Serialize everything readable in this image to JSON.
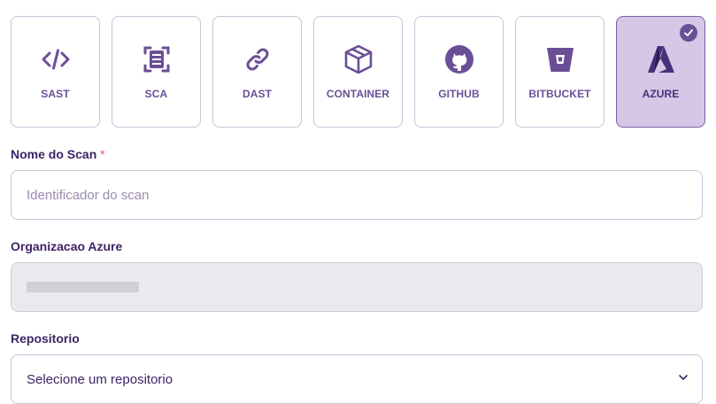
{
  "scan_types": [
    {
      "label": "SAST",
      "icon": "code-icon",
      "selected": false
    },
    {
      "label": "SCA",
      "icon": "document-scan-icon",
      "selected": false
    },
    {
      "label": "DAST",
      "icon": "link-icon",
      "selected": false
    },
    {
      "label": "CONTAINER",
      "icon": "box-icon",
      "selected": false
    },
    {
      "label": "GITHUB",
      "icon": "github-icon",
      "selected": false
    },
    {
      "label": "BITBUCKET",
      "icon": "bitbucket-icon",
      "selected": false
    },
    {
      "label": "AZURE",
      "icon": "azure-icon",
      "selected": true
    }
  ],
  "form": {
    "scan_name_label": "Nome do Scan",
    "required_mark": "*",
    "scan_name_placeholder": "Identificador do scan",
    "organization_label": "Organizacao Azure",
    "repository_label": "Repositorio",
    "repository_value": "Selecione um repositorio"
  },
  "colors": {
    "accent": "#6a4f96",
    "selected_bg": "#d6c7e6",
    "label_text": "#3d2466",
    "required": "#e05a6a"
  }
}
